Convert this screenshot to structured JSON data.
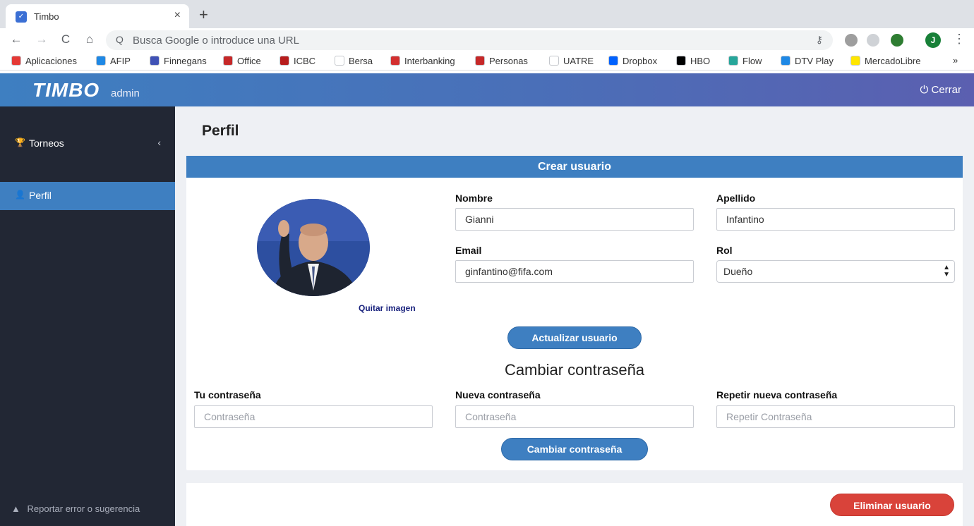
{
  "browser": {
    "tab_title": "Timbo",
    "tab_close": "×",
    "new_tab": "+",
    "back_icon": "←",
    "forward_icon": "→",
    "reload_icon": "C",
    "home_icon": "⌂",
    "search_icon": "Q",
    "omnibox_placeholder": "Busca Google o introduce una URL",
    "key_icon": "⚷",
    "profile_initial": "J",
    "menu_icon": "⋮",
    "bookmarks": [
      {
        "label": "Aplicaciones",
        "color": "#e53935"
      },
      {
        "label": "AFIP",
        "color": "#1e88e5"
      },
      {
        "label": "Finnegans",
        "color": "#3f51b5"
      },
      {
        "label": "Office",
        "color": "#c62828"
      },
      {
        "label": "ICBC",
        "color": "#b71c1c"
      },
      {
        "label": "Bersa",
        "color": "#ffffff"
      },
      {
        "label": "Interbanking",
        "color": "#d32f2f"
      },
      {
        "label": "Personas",
        "color": "#c62828"
      },
      {
        "label": "UATRE",
        "color": "#ffffff"
      },
      {
        "label": "Dropbox",
        "color": "#0061fe"
      },
      {
        "label": "HBO",
        "color": "#000000"
      },
      {
        "label": "Flow",
        "color": "#26a69a"
      },
      {
        "label": "DTV Play",
        "color": "#1e88e5"
      },
      {
        "label": "MercadoLibre",
        "color": "#ffe600"
      }
    ],
    "bookmarks_more": "»"
  },
  "header": {
    "logo": "TIMBO",
    "logo_suffix": "admin",
    "logout_icon": "⏻",
    "logout_label": "Cerrar"
  },
  "sidebar": {
    "items": [
      {
        "label": "Torneos",
        "icon": "trophy-icon",
        "glyph": "🏆",
        "chevron": "‹"
      },
      {
        "label": "Perfil",
        "icon": "user-icon",
        "glyph": "👤"
      }
    ],
    "footer_icon": "▲",
    "footer_label": "Reportar error o sugerencia"
  },
  "main": {
    "page_title": "Perfil",
    "card_title": "Crear usuario",
    "remove_image": "Quitar imagen",
    "fields": {
      "nombre_label": "Nombre",
      "nombre_value": "Gianni",
      "apellido_label": "Apellido",
      "apellido_value": "Infantino",
      "email_label": "Email",
      "email_value": "ginfantino@fifa.com",
      "rol_label": "Rol",
      "rol_value": "Dueño"
    },
    "update_button": "Actualizar usuario",
    "password_section_title": "Cambiar contraseña",
    "password": {
      "current_label": "Tu contraseña",
      "current_placeholder": "Contraseña",
      "new_label": "Nueva contraseña",
      "new_placeholder": "Contraseña",
      "repeat_label": "Repetir nueva contraseña",
      "repeat_placeholder": "Repetir Contraseña"
    },
    "change_password_button": "Cambiar contraseña",
    "delete_button": "Eliminar usuario"
  },
  "colors": {
    "primary": "#3e7fc1",
    "sidebar_bg": "#222734",
    "danger": "#d9433a",
    "content_bg": "#eef0f4"
  }
}
